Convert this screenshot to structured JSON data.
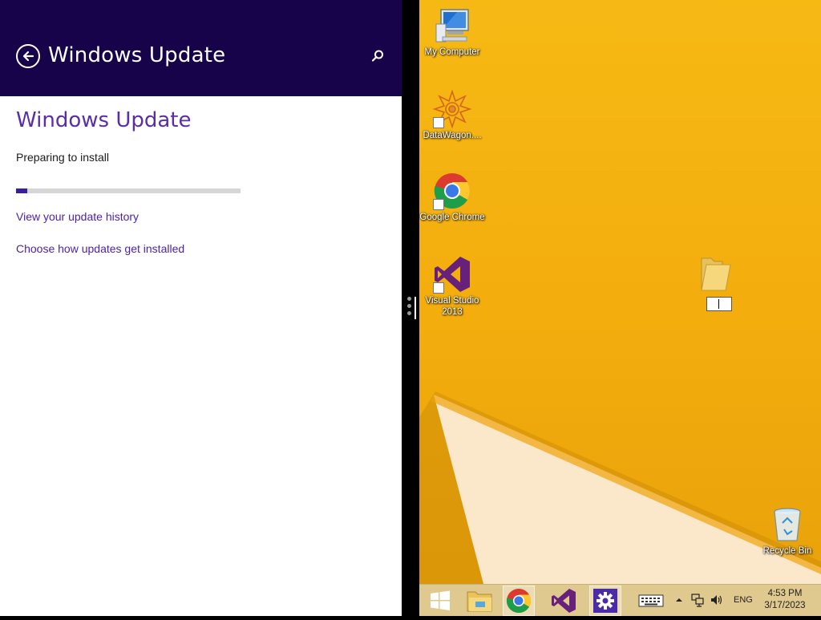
{
  "settings_pane": {
    "header_title": "Windows Update",
    "heading": "Windows Update",
    "status": "Preparing to install",
    "progress_fraction": 0.05,
    "links": {
      "history": "View your update history",
      "choose": "Choose how updates get installed"
    },
    "icons": {
      "back": "back-arrow-icon",
      "search": "search-icon"
    },
    "colors": {
      "header_bg": "#170349",
      "accent": "#5a2ea6",
      "progress": "#3b1e9e"
    }
  },
  "desktop": {
    "icons": [
      {
        "label": "My Computer",
        "icon": "computer-icon"
      },
      {
        "label": "DataWagon....",
        "icon": "datawagon-icon"
      },
      {
        "label": "Google Chrome",
        "icon": "chrome-icon"
      },
      {
        "label": "Visual Studio 2013",
        "icon": "visual-studio-icon"
      },
      {
        "label": "Recycle Bin",
        "icon": "recycle-bin-icon"
      }
    ],
    "new_folder_name": "",
    "colors": {
      "wallpaper": "#f3ad0d"
    }
  },
  "taskbar": {
    "pinned": [
      "windows-start-icon",
      "file-explorer-icon",
      "chrome-icon",
      "visual-studio-icon",
      "settings-icon"
    ],
    "tray": {
      "language": "ENG",
      "time": "4:53 PM",
      "date": "3/17/2023"
    }
  }
}
